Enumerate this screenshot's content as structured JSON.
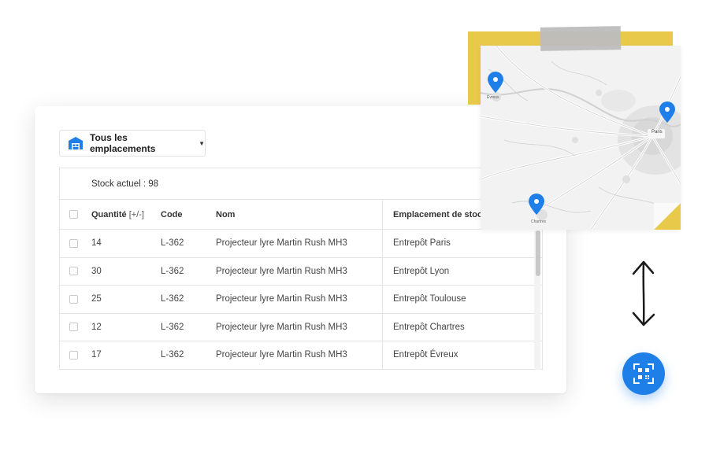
{
  "location_select": {
    "label": "Tous les emplacements",
    "icon": "warehouse-icon",
    "caret": "▼"
  },
  "stock": {
    "label": "Stock actuel : 98"
  },
  "table": {
    "headers": {
      "qty": "Quantité",
      "qty_hint": "[+/-]",
      "code": "Code",
      "nom": "Nom",
      "location": "Emplacement de stock"
    },
    "rows": [
      {
        "qty": "14",
        "code": "L-362",
        "nom": "Projecteur lyre Martin Rush MH3",
        "location": "Entrepôt Paris"
      },
      {
        "qty": "30",
        "code": "L-362",
        "nom": "Projecteur lyre Martin Rush MH3",
        "location": "Entrepôt Lyon"
      },
      {
        "qty": "25",
        "code": "L-362",
        "nom": "Projecteur lyre Martin Rush MH3",
        "location": "Entrepôt Toulouse"
      },
      {
        "qty": "12",
        "code": "L-362",
        "nom": "Projecteur lyre Martin Rush MH3",
        "location": "Entrepôt Chartres"
      },
      {
        "qty": "17",
        "code": "L-362",
        "nom": "Projecteur lyre Martin Rush MH3",
        "location": "Entrepôt Évreux"
      }
    ]
  },
  "map": {
    "city_label": "Paris",
    "secondary_labels": [
      "Évreux",
      "Chartres"
    ]
  },
  "colors": {
    "accent": "#1f7fe8",
    "paper_yellow": "#e8c94a",
    "tape": "#bdbdbd"
  },
  "qr_button": {
    "icon": "qr-code-icon"
  }
}
